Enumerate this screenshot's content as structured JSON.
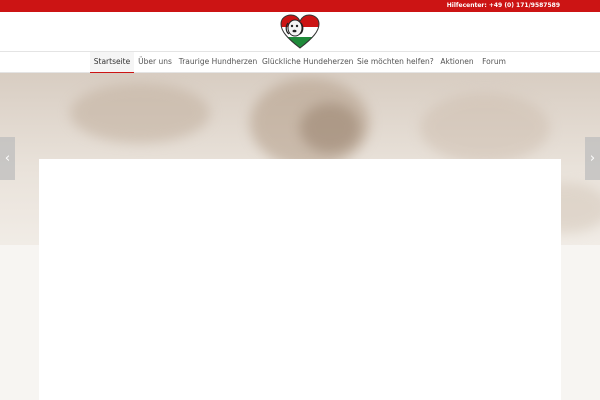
{
  "topbar": {
    "hotline": "Hilfecenter: +49 (0) 171/9587589"
  },
  "logo": {
    "icon": "heart-flag-icon",
    "colors": [
      "#cc1414",
      "#ffffff",
      "#1f8a3a"
    ]
  },
  "nav": {
    "items": [
      {
        "label": "Startseite",
        "active": true
      },
      {
        "label": "Über uns"
      },
      {
        "label": "Traurige Hundherzen"
      },
      {
        "label": "Glückliche Hundeherzen"
      },
      {
        "label": "Sie möchten helfen?"
      },
      {
        "label": "Aktionen"
      },
      {
        "label": "Forum"
      }
    ]
  },
  "slider": {
    "prev": "‹",
    "next": "›"
  },
  "colors": {
    "accent": "#cc1414",
    "background": "#f7f5f2"
  }
}
